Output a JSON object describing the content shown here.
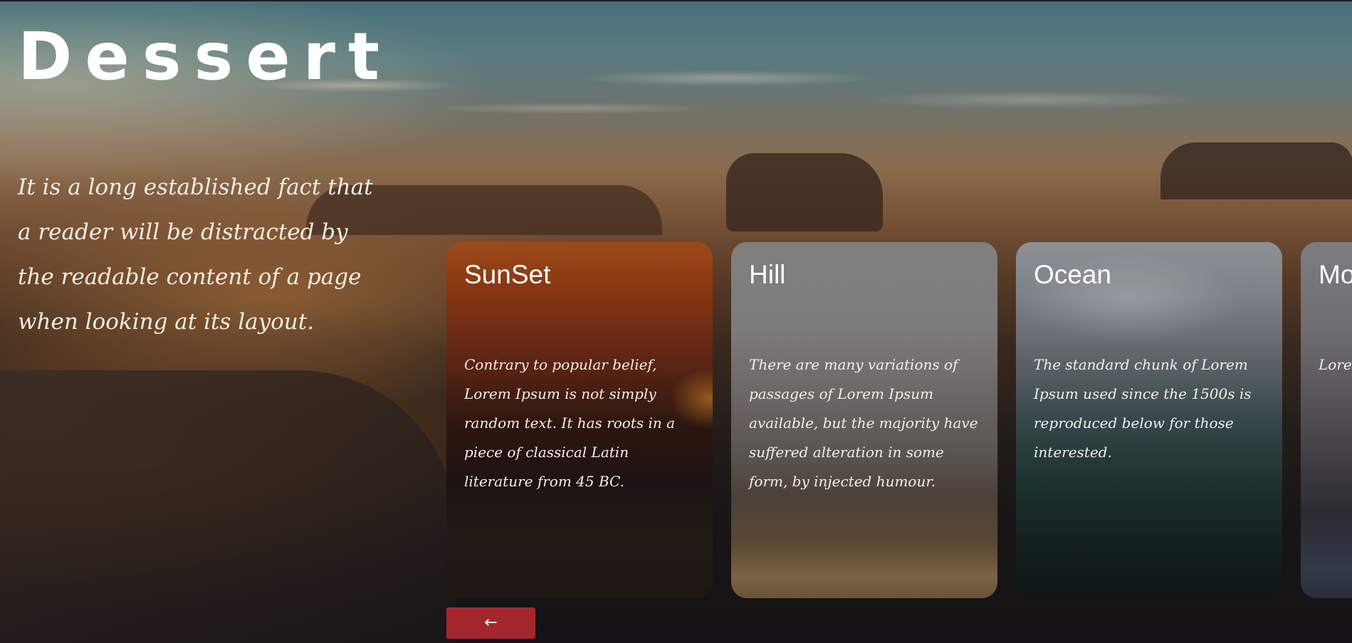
{
  "hero": {
    "title": "Dessert",
    "intro": "It is a long established fact that a reader will be distracted by the readable content of a page when looking at its layout."
  },
  "cards": [
    {
      "title": "SunSet",
      "text": "Contrary to popular belief, Lorem Ipsum is not simply random text. It has roots in a piece of classical Latin literature from 45 BC."
    },
    {
      "title": "Hill",
      "text": "There are many variations of passages of Lorem Ipsum available, but the majority have suffered alteration in some form, by injected humour."
    },
    {
      "title": "Ocean",
      "text": "The standard chunk of Lorem Ipsum used since the 1500s is reproduced below for those interested."
    },
    {
      "title": "Mo",
      "text": "Lorem free fr huma word"
    }
  ],
  "controls": {
    "prev_label": "←"
  },
  "colors": {
    "button": "#a4262d",
    "text": "#ffffff"
  }
}
